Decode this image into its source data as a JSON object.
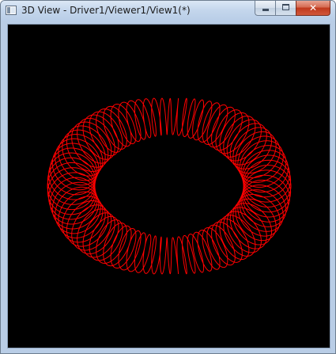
{
  "window": {
    "title": "3D View - Driver1/Viewer1/View1(*)",
    "controls": {
      "minimize_icon": "minimize-icon",
      "maximize_icon": "maximize-icon",
      "close_icon": "close-icon",
      "close_glyph": "✕"
    }
  },
  "viewport": {
    "background_color": "#000000",
    "shape": "helical-coil-torus",
    "stroke_color": "#ff0000"
  }
}
